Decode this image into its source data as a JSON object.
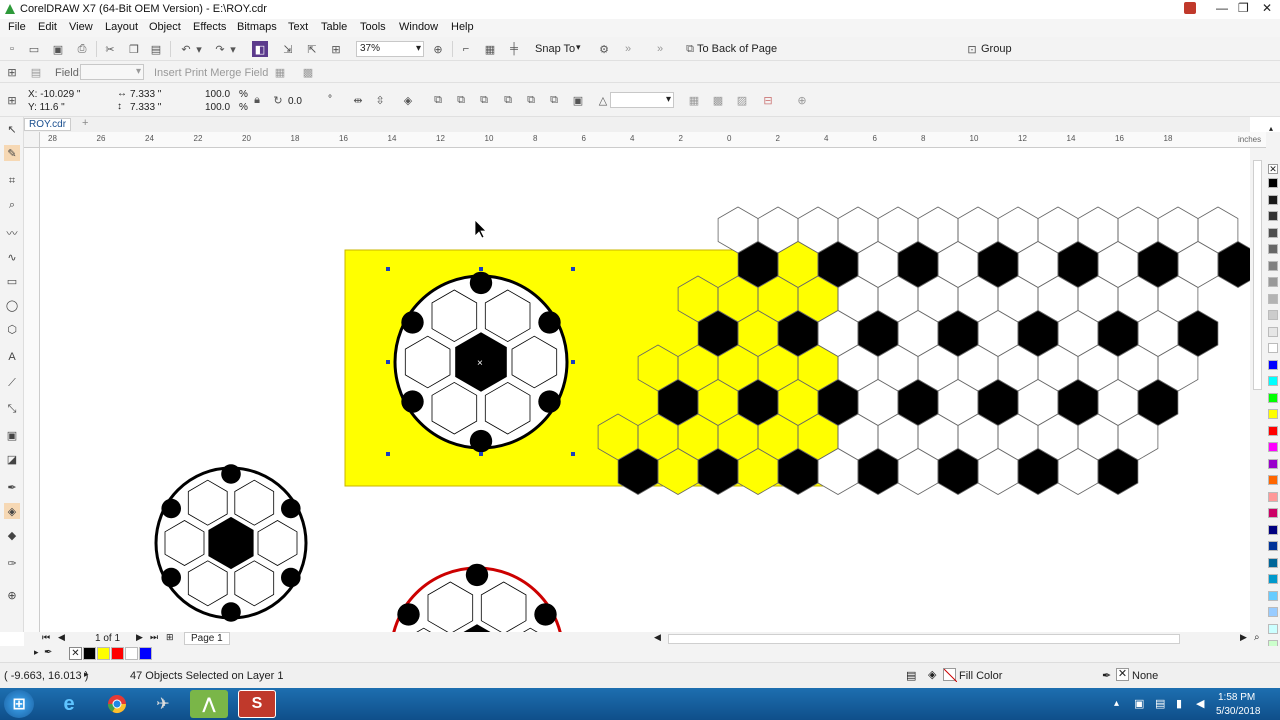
{
  "window": {
    "title": "CorelDRAW X7 (64-Bit OEM Version) - E:\\ROY.cdr",
    "controls": [
      "—",
      "❐",
      "✕"
    ]
  },
  "menu": [
    "File",
    "Edit",
    "View",
    "Layout",
    "Object",
    "Effects",
    "Bitmaps",
    "Text",
    "Table",
    "Tools",
    "Window",
    "Help"
  ],
  "standard_toolbar": {
    "zoom_value": "37%",
    "snap_to_label": "Snap To",
    "to_back_label": "To Back of Page",
    "group_label": "Group"
  },
  "merge_toolbar": {
    "field_label": "Field:",
    "insert_label": "Insert Print Merge Field"
  },
  "property_bar": {
    "x": "X: -10.029 \"",
    "y": "Y: 11.6 \"",
    "w": "7.333 \"",
    "h": "7.333 \"",
    "scale_x": "100.0",
    "scale_y": "100.0",
    "pct": "%",
    "angle": "0.0",
    "deg": "°"
  },
  "document": {
    "tab_name": "ROY.cdr",
    "ruler_units": "inches"
  },
  "ruler_ticks": [
    "28",
    "26",
    "24",
    "22",
    "20",
    "18",
    "16",
    "14",
    "12",
    "10",
    "8",
    "6",
    "4",
    "2",
    "0",
    "2",
    "4",
    "6",
    "8",
    "10",
    "12",
    "14",
    "16",
    "18"
  ],
  "page_nav": {
    "page_count": "1 of 1",
    "page_tab": "Page 1"
  },
  "status": {
    "coords": "( -9.663, 16.013 )",
    "selection": "47 Objects Selected on Layer 1",
    "fill_label": "Fill Color",
    "outline_label": "None"
  },
  "doc_palette_colors": [
    "#000000",
    "#ffff00",
    "#ff0000",
    "#ffffff",
    "#0000ff"
  ],
  "palette_colors": [
    "#000000",
    "#1a1a1a",
    "#333333",
    "#4d4d4d",
    "#666666",
    "#808080",
    "#999999",
    "#b3b3b3",
    "#cccccc",
    "#e6e6e6",
    "#ffffff",
    "#0000ff",
    "#00ffff",
    "#00ff00",
    "#ffff00",
    "#ff0000",
    "#ff00ff",
    "#9900cc",
    "#ff6600",
    "#ff9999",
    "#cc0066",
    "#000080",
    "#003399",
    "#006699",
    "#0099cc",
    "#66ccff",
    "#99ccff",
    "#ccffff",
    "#ccffcc"
  ],
  "tray": {
    "time": "1:58 PM",
    "date": "5/30/2018"
  },
  "canvas": {
    "accent_yellow": "#ffff00"
  }
}
